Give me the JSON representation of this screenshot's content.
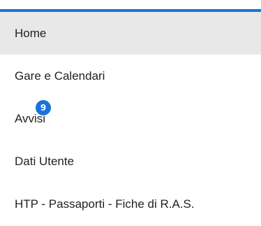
{
  "theme": {
    "accent": "#1a73d9",
    "active_bg": "#e8e8e8",
    "text": "#222222"
  },
  "menu": {
    "items": [
      {
        "label": "Home",
        "active": true
      },
      {
        "label": "Gare e Calendari",
        "active": false
      },
      {
        "label": "Avvisi",
        "active": false,
        "badge": "9"
      },
      {
        "label": "Dati Utente",
        "active": false
      },
      {
        "label": "HTP - Passaporti - Fiche di R.A.S.",
        "active": false
      }
    ]
  }
}
